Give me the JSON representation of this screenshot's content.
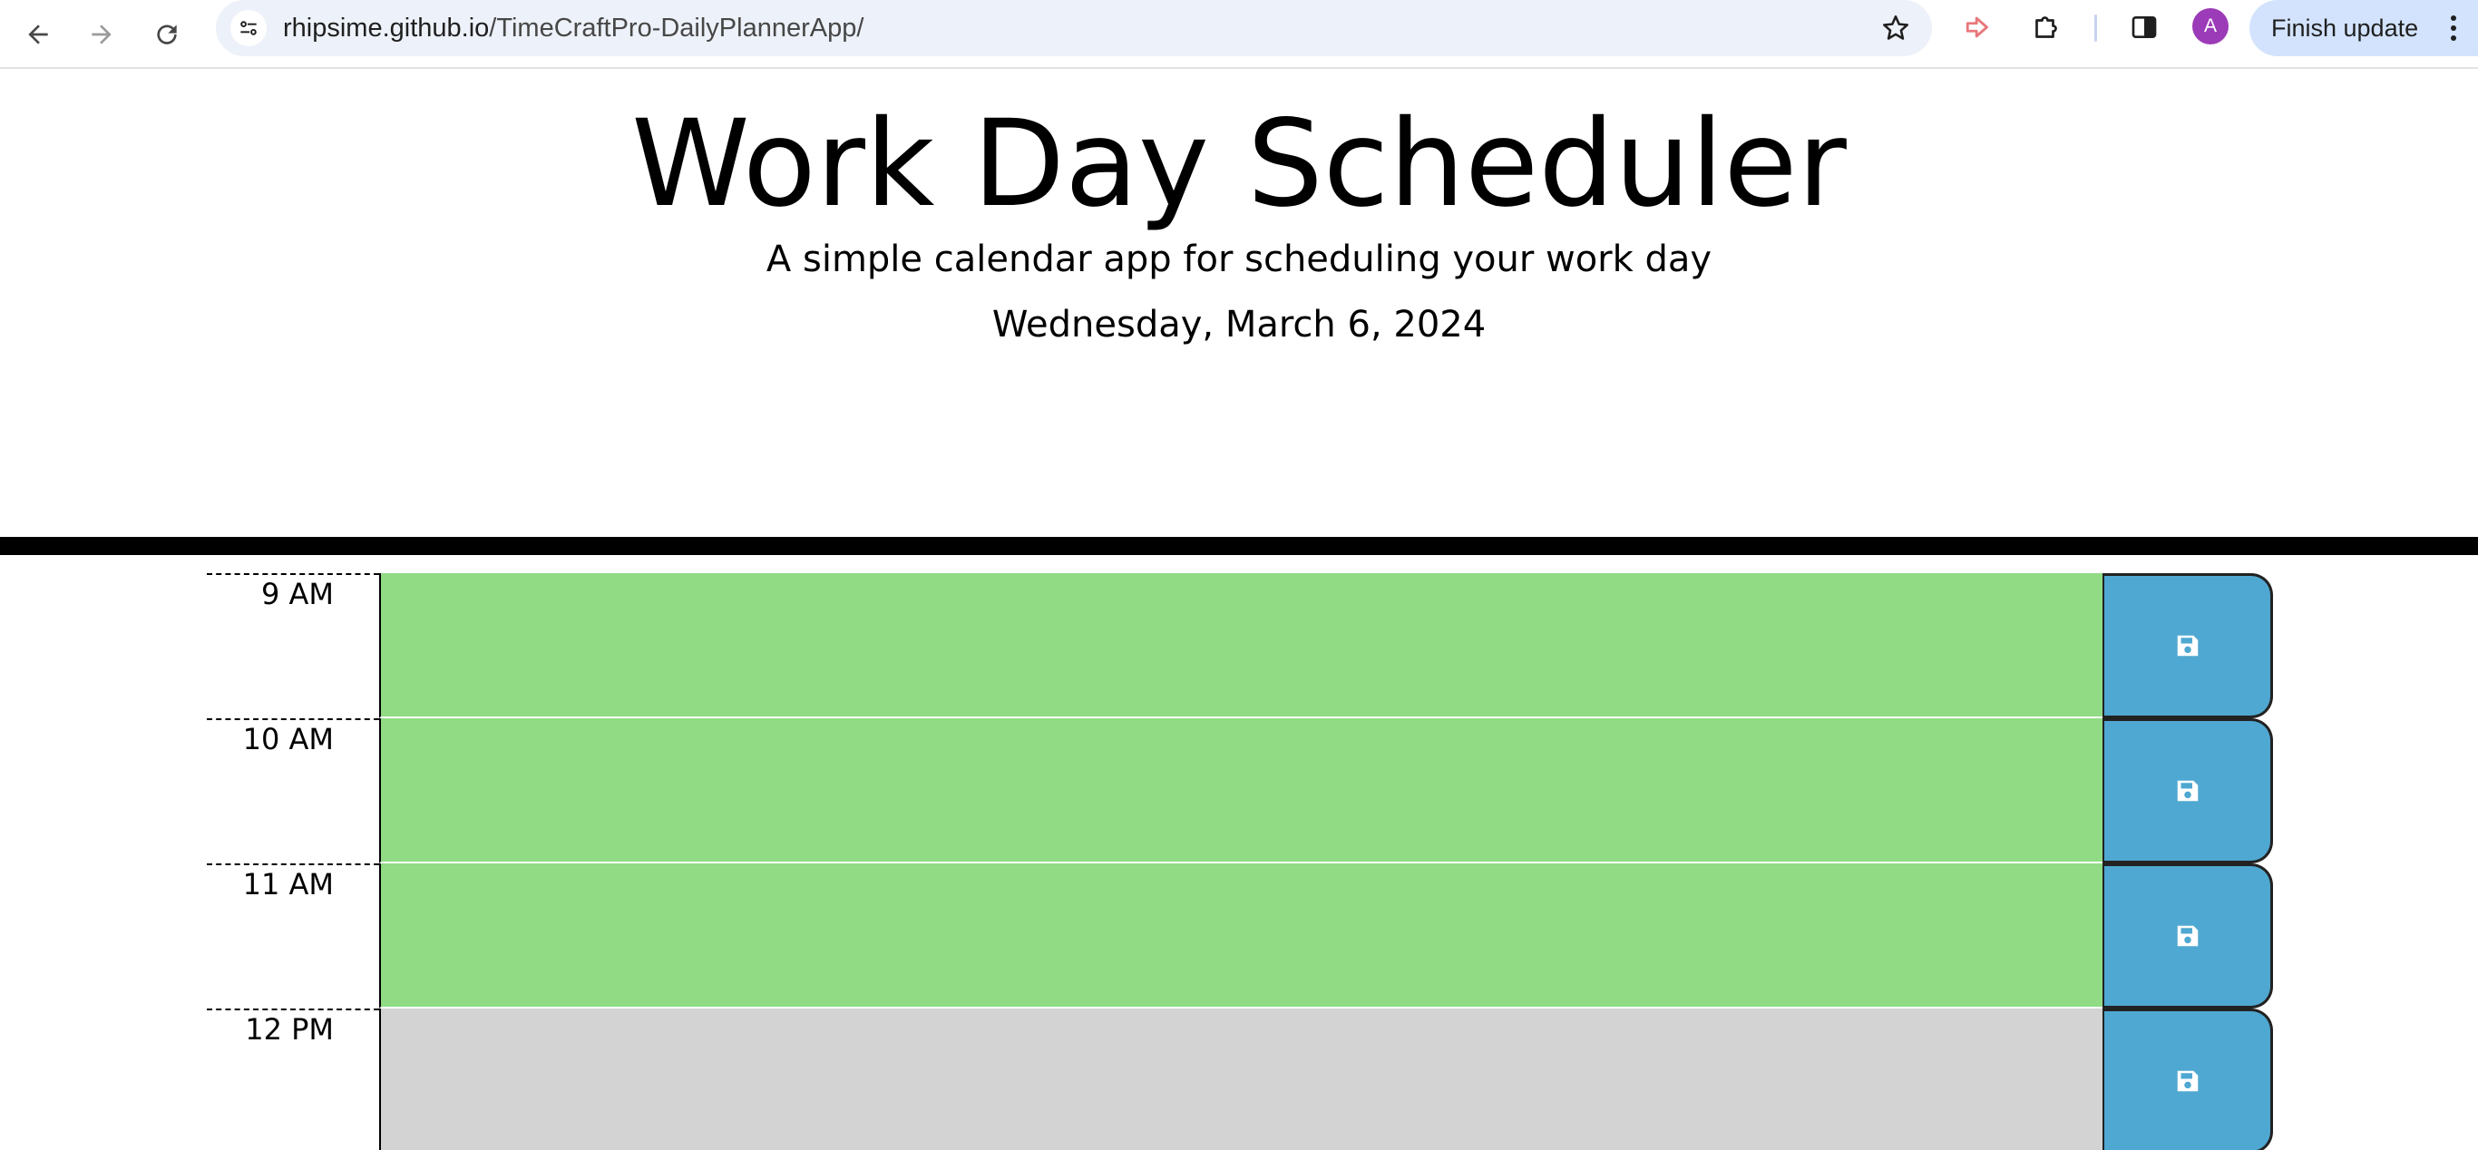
{
  "browser": {
    "url_host": "rhipsime.github.io",
    "url_path": "/TimeCraftPro-DailyPlannerApp/",
    "profile_initial": "A",
    "update_button_label": "Finish update"
  },
  "header": {
    "title": "Work Day Scheduler",
    "subtitle": "A simple calendar app for scheduling your work day",
    "current_date": "Wednesday, March 6, 2024"
  },
  "time_blocks": [
    {
      "hour_label": "9 AM",
      "status": "future",
      "color": "#90db84",
      "text": ""
    },
    {
      "hour_label": "10 AM",
      "status": "future",
      "color": "#90db84",
      "text": ""
    },
    {
      "hour_label": "11 AM",
      "status": "future",
      "color": "#90db84",
      "text": ""
    },
    {
      "hour_label": "12 PM",
      "status": "past",
      "color": "#d3d3d3",
      "text": ""
    }
  ],
  "colors": {
    "future": "#90db84",
    "past": "#d3d3d3",
    "save_button": "#4fa8d1",
    "header_rule": "#000000"
  },
  "icons": {
    "save": "floppy-disk-icon"
  }
}
